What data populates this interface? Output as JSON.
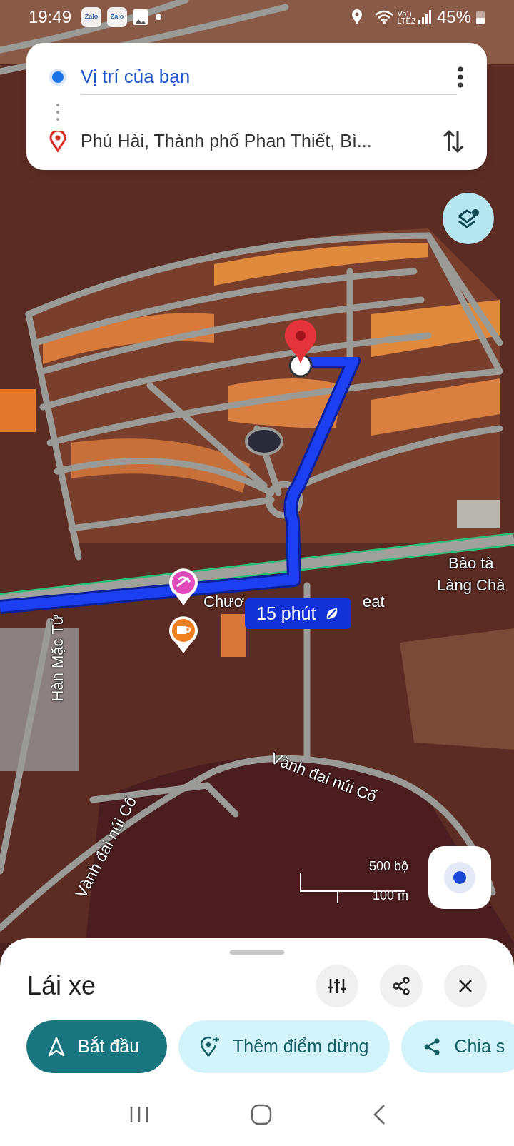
{
  "status_bar": {
    "time": "19:49",
    "notifications": [
      {
        "kind": "app",
        "label": "Zalo"
      },
      {
        "kind": "app",
        "label": "Zalo"
      },
      {
        "kind": "gallery"
      },
      {
        "kind": "dot"
      }
    ],
    "network_top": "Vo))",
    "network_bottom": "LTE2",
    "battery": "45%"
  },
  "route": {
    "origin": "Vị trí của bạn",
    "destination": "Phú Hài, Thành phố Phan Thiết, Bì..."
  },
  "map": {
    "labels": [
      "Chươ",
      "eat",
      "Bảo tà",
      "Làng Chà",
      "Hàn Mặc Tử",
      "Vành đai núi Cố",
      "Vành đai núi Cố"
    ],
    "route_badge": "15 phút",
    "scale": {
      "imperial": "500 bộ",
      "metric": "100 m"
    }
  },
  "sheet": {
    "title": "Lái xe",
    "actions": [
      {
        "kind": "start",
        "label": "Bắt đầu"
      },
      {
        "kind": "add_stop",
        "label": "Thêm điểm dừng"
      },
      {
        "kind": "share",
        "label": "Chia s"
      }
    ]
  }
}
